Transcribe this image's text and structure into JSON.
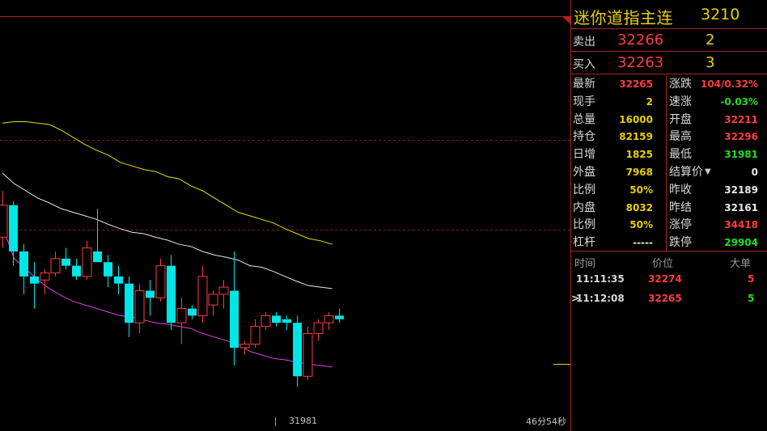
{
  "title": {
    "name": "迷你道指主连",
    "code": "3210"
  },
  "sell": {
    "label": "卖出",
    "price": "32266",
    "volume": "2"
  },
  "buy": {
    "label": "买入",
    "price": "32263",
    "volume": "3"
  },
  "stats_left": [
    {
      "label": "最新",
      "value": "32265",
      "color": "#ff3c3c"
    },
    {
      "label": "现手",
      "value": "2",
      "color": "#e8d000"
    },
    {
      "label": "总量",
      "value": "16000",
      "color": "#e8d000"
    },
    {
      "label": "持仓",
      "value": "82159",
      "color": "#e8d000"
    },
    {
      "label": "日增",
      "value": "1825",
      "color": "#e8d000"
    },
    {
      "label": "外盘",
      "value": "7968",
      "color": "#e8d000"
    },
    {
      "label": "比例",
      "value": "50%",
      "color": "#e8d000"
    },
    {
      "label": "内盘",
      "value": "8032",
      "color": "#e8d000"
    },
    {
      "label": "比例",
      "value": "50%",
      "color": "#e8d000"
    },
    {
      "label": "杠杆",
      "value": "-----",
      "color": "#e8e8e8"
    }
  ],
  "stats_right": [
    {
      "label": "涨跌",
      "value": "104/0.32%",
      "color": "#ff3c3c"
    },
    {
      "label": "速涨",
      "value": "-0.03%",
      "color": "#22dd22"
    },
    {
      "label": "开盘",
      "value": "32211",
      "color": "#ff3c3c"
    },
    {
      "label": "最高",
      "value": "32296",
      "color": "#ff3c3c"
    },
    {
      "label": "最低",
      "value": "31981",
      "color": "#22dd22"
    },
    {
      "label": "结算价",
      "value": "0",
      "color": "#e8e8e8",
      "dropdown": true
    },
    {
      "label": "昨收",
      "value": "32189",
      "color": "#e8e8e8"
    },
    {
      "label": "昨结",
      "value": "32161",
      "color": "#e8e8e8"
    },
    {
      "label": "涨停",
      "value": "34418",
      "color": "#ff3c3c"
    },
    {
      "label": "跌停",
      "value": "29904",
      "color": "#22dd22"
    }
  ],
  "ticks": {
    "headers": [
      "时间",
      "价位",
      "大单"
    ],
    "rows": [
      {
        "time": "11:11:35",
        "price": "32274",
        "volume": "5",
        "vol_color": "#ff3c3c",
        "marker": ""
      },
      {
        "time": "11:12:08",
        "price": "32265",
        "volume": "5",
        "vol_color": "#22dd22",
        "marker": ">"
      }
    ]
  },
  "chart_labels": {
    "low_price": "31981",
    "countdown": "46分54秒"
  },
  "chart_data": {
    "type": "candlestick",
    "ylim": [
      31900,
      32450
    ],
    "candles": [
      {
        "o": 32140,
        "h": 32205,
        "l": 32125,
        "c": 32185
      },
      {
        "o": 32185,
        "h": 32190,
        "l": 32100,
        "c": 32120
      },
      {
        "o": 32120,
        "h": 32130,
        "l": 32060,
        "c": 32085
      },
      {
        "o": 32085,
        "h": 32105,
        "l": 32040,
        "c": 32075
      },
      {
        "o": 32080,
        "h": 32095,
        "l": 32060,
        "c": 32090
      },
      {
        "o": 32090,
        "h": 32120,
        "l": 32085,
        "c": 32110
      },
      {
        "o": 32110,
        "h": 32125,
        "l": 32095,
        "c": 32100
      },
      {
        "o": 32100,
        "h": 32110,
        "l": 32080,
        "c": 32085
      },
      {
        "o": 32085,
        "h": 32135,
        "l": 32080,
        "c": 32125
      },
      {
        "o": 32120,
        "h": 32180,
        "l": 32115,
        "c": 32105
      },
      {
        "o": 32105,
        "h": 32115,
        "l": 32070,
        "c": 32085
      },
      {
        "o": 32085,
        "h": 32100,
        "l": 32060,
        "c": 32075
      },
      {
        "o": 32075,
        "h": 32085,
        "l": 32000,
        "c": 32020
      },
      {
        "o": 32020,
        "h": 32075,
        "l": 32005,
        "c": 32065
      },
      {
        "o": 32065,
        "h": 32080,
        "l": 32030,
        "c": 32055
      },
      {
        "o": 32055,
        "h": 32110,
        "l": 32050,
        "c": 32100
      },
      {
        "o": 32100,
        "h": 32115,
        "l": 32010,
        "c": 32020
      },
      {
        "o": 32020,
        "h": 32055,
        "l": 31990,
        "c": 32040
      },
      {
        "o": 32040,
        "h": 32045,
        "l": 32025,
        "c": 32030
      },
      {
        "o": 32030,
        "h": 32100,
        "l": 32020,
        "c": 32085
      },
      {
        "o": 32045,
        "h": 32065,
        "l": 32030,
        "c": 32060
      },
      {
        "o": 32060,
        "h": 32080,
        "l": 32040,
        "c": 32070
      },
      {
        "o": 32065,
        "h": 32120,
        "l": 31960,
        "c": 31985
      },
      {
        "o": 31985,
        "h": 31995,
        "l": 31975,
        "c": 31990
      },
      {
        "o": 31990,
        "h": 32025,
        "l": 31985,
        "c": 32015
      },
      {
        "o": 32015,
        "h": 32035,
        "l": 32010,
        "c": 32030
      },
      {
        "o": 32030,
        "h": 32035,
        "l": 32015,
        "c": 32020
      },
      {
        "o": 32025,
        "h": 32030,
        "l": 32010,
        "c": 32020
      },
      {
        "o": 32020,
        "h": 32030,
        "l": 31930,
        "c": 31945
      },
      {
        "o": 31945,
        "h": 32015,
        "l": 31940,
        "c": 32005
      },
      {
        "o": 32005,
        "h": 32025,
        "l": 31995,
        "c": 32020
      },
      {
        "o": 32020,
        "h": 32035,
        "l": 32010,
        "c": 32030
      },
      {
        "o": 32030,
        "h": 32040,
        "l": 32020,
        "c": 32025
      }
    ],
    "yellow_band": [
      32300,
      32302,
      32302,
      32300,
      32298,
      32290,
      32280,
      32270,
      32262,
      32255,
      32245,
      32240,
      32235,
      32232,
      32225,
      32222,
      32212,
      32205,
      32195,
      32185,
      32175,
      32170,
      32165,
      32160,
      32152,
      32145,
      32138,
      32135,
      32130
    ],
    "white_band": [
      32230,
      32215,
      32205,
      32195,
      32188,
      32180,
      32175,
      32170,
      32165,
      32158,
      32152,
      32147,
      32145,
      32140,
      32136,
      32130,
      32127,
      32120,
      32115,
      32112,
      32108,
      32100,
      32098,
      32092,
      32085,
      32078,
      32072,
      32070,
      32068
    ],
    "magenta_band": [
      32155,
      32110,
      32095,
      32080,
      32068,
      32058,
      32050,
      32045,
      32040,
      32035,
      32030,
      32028,
      32024,
      32020,
      32018,
      32015,
      32012,
      32005,
      32000,
      31995,
      31990,
      31980,
      31975,
      31970,
      31968,
      31965,
      31962,
      31960,
      31958
    ]
  }
}
